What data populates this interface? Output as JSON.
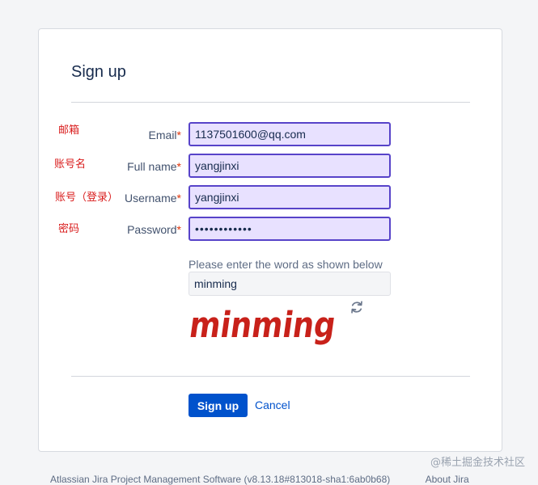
{
  "form": {
    "title": "Sign up",
    "hint": "Please enter the word as shown below",
    "fields": [
      {
        "label": "Email",
        "required_mark": "*",
        "value": "1137501600@qq.com",
        "annotation": "邮箱"
      },
      {
        "label": "Full name",
        "required_mark": "*",
        "value": "yangjinxi",
        "annotation": "账号名"
      },
      {
        "label": "Username",
        "required_mark": "*",
        "value": "yangjinxi",
        "annotation": "账号（登录）"
      },
      {
        "label": "Password",
        "required_mark": "*",
        "value": "••••••••••••",
        "annotation": "密码"
      }
    ],
    "captcha": {
      "input_value": "minming",
      "image_text": "minming",
      "refresh_icon": "refresh-icon"
    },
    "signup_label": "Sign up",
    "cancel_label": "Cancel"
  },
  "footer": {
    "text": "Atlassian Jira Project Management Software (v8.13.18#813018-sha1:6ab0b68)",
    "about": "About Jira"
  },
  "watermark": "@稀土掘金技术社区",
  "colors": {
    "primary": "#0052cc",
    "annotation": "#d91c1c",
    "field_highlight": "#e8e1ff",
    "field_border": "#5743c9",
    "captcha": "#c8211a"
  }
}
